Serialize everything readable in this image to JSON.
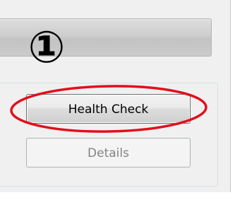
{
  "marker": "①",
  "buttons": {
    "health_check": "Health Check",
    "details": "Details"
  },
  "colors": {
    "highlight": "#e0101c",
    "disabled_text": "#838383"
  }
}
